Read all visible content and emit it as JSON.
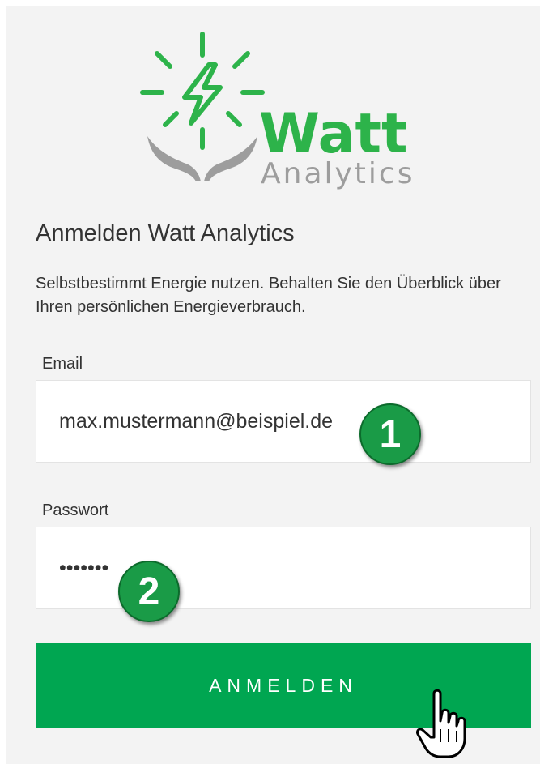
{
  "brand": {
    "logo_word": "Watt",
    "logo_sub": "Analytics",
    "green": "#2db34a",
    "gray": "#9d9d9d"
  },
  "header": {
    "title": "Anmelden Watt Analytics",
    "subtitle": "Selbstbestimmt Energie nutzen. Behalten Sie den Überblick über Ihren persönlichen Energieverbrauch."
  },
  "form": {
    "email": {
      "label": "Email",
      "value": "max.mustermann@beispiel.de"
    },
    "password": {
      "label": "Passwort",
      "value": "•••••••"
    },
    "submit_label": "ANMELDEN"
  },
  "annotations": {
    "step1": "1",
    "step2": "2"
  },
  "colors": {
    "accent": "#00a651",
    "background": "#f3f3f3"
  }
}
